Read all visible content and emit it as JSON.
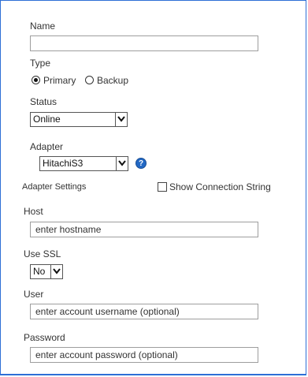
{
  "form": {
    "name_label": "Name",
    "name_value": "",
    "type_label": "Type",
    "type_options": [
      {
        "label": "Primary",
        "selected": true
      },
      {
        "label": "Backup",
        "selected": false
      }
    ],
    "status_label": "Status",
    "status_value": "Online",
    "adapter_label": "Adapter",
    "adapter_value": "HitachiS3",
    "help_icon_text": "?",
    "adapter_settings_label": "Adapter Settings",
    "show_connection_string_label": "Show Connection String",
    "show_connection_string_checked": false,
    "host_label": "Host",
    "host_placeholder": "enter hostname",
    "use_ssl_label": "Use SSL",
    "use_ssl_value": "No",
    "user_label": "User",
    "user_placeholder": "enter account username (optional)",
    "password_label": "Password",
    "password_placeholder": "enter account password (optional)"
  },
  "colors": {
    "frame_border": "#2e6fd6",
    "help_icon": "#2268c4"
  }
}
